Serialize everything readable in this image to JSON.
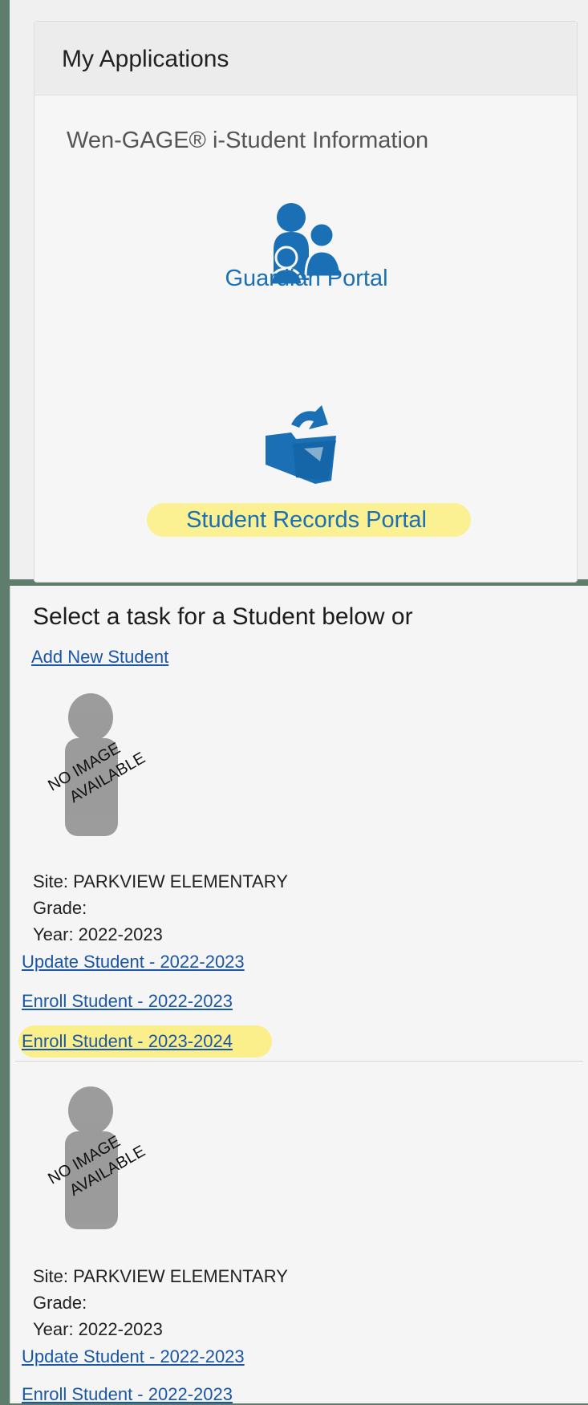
{
  "applications_panel": {
    "heading": "My Applications",
    "app_name": "Wen-GAGE® i-Student Information",
    "portals": [
      {
        "label": "Guardian Portal",
        "icon": "family-icon"
      },
      {
        "label": "Student Records Portal",
        "icon": "folder-icon",
        "highlighted": true
      }
    ]
  },
  "task_panel": {
    "heading": "Select a task for a Student below or",
    "add_link": "Add New Student",
    "no_image_text": [
      "NO IMAGE",
      "AVAILABLE"
    ],
    "students": [
      {
        "site": "Site: PARKVIEW ELEMENTARY",
        "grade": "Grade:",
        "year": "Year: 2022-2023",
        "links": [
          {
            "label": "Update Student - 2022-2023"
          },
          {
            "label": "Enroll Student - 2022-2023"
          },
          {
            "label": "Enroll Student - 2023-2024",
            "highlighted": true
          }
        ]
      },
      {
        "site": "Site: PARKVIEW ELEMENTARY",
        "grade": "Grade:",
        "year": "Year: 2022-2023",
        "links": [
          {
            "label": "Update Student - 2022-2023"
          },
          {
            "label": "Enroll Student - 2022-2023"
          }
        ]
      }
    ]
  },
  "colors": {
    "link": "#1a56a6",
    "portal_blue": "#1a6fb5",
    "highlight": "#fbef8c"
  }
}
